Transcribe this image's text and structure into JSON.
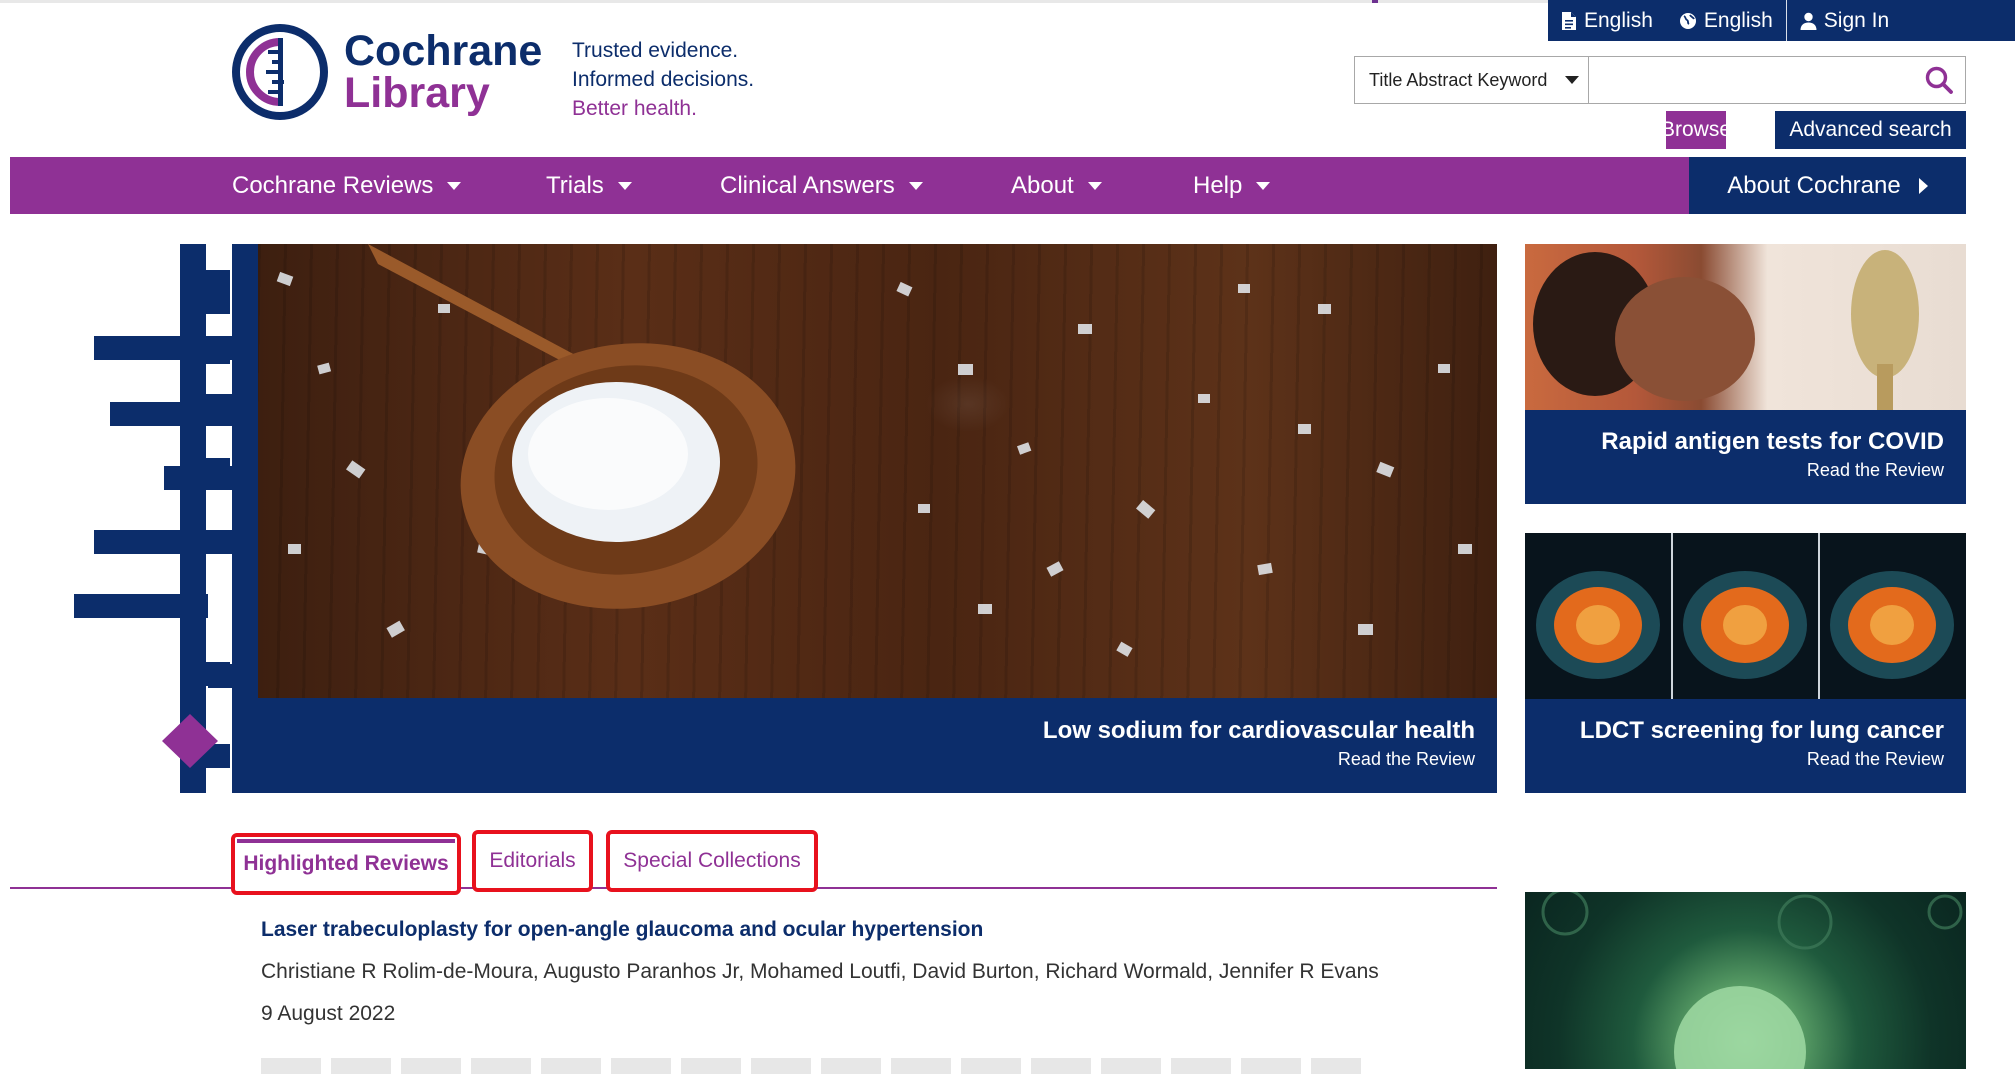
{
  "utility": {
    "items": [
      {
        "label": "English",
        "icon": "document-icon"
      },
      {
        "label": "English",
        "icon": "globe-icon"
      },
      {
        "label": "Sign In",
        "icon": "user-icon"
      }
    ]
  },
  "logo": {
    "line1": "Cochrane",
    "line2": "Library"
  },
  "tagline": {
    "line1": "Trusted evidence.",
    "line2": "Informed decisions.",
    "line3": "Better health."
  },
  "search": {
    "scope": "Title Abstract Keyword",
    "value": "",
    "placeholder": ""
  },
  "buttons": {
    "browse": "Browse",
    "advanced": "Advanced search"
  },
  "nav": {
    "items": [
      {
        "label": "Cochrane Reviews"
      },
      {
        "label": "Trials"
      },
      {
        "label": "Clinical Answers"
      },
      {
        "label": "About"
      },
      {
        "label": "Help"
      }
    ],
    "about_cochrane": "About Cochrane"
  },
  "hero": {
    "title": "Low sodium for cardiovascular health",
    "sub": "Read the Review"
  },
  "side": [
    {
      "title": "Rapid antigen tests for COVID",
      "sub": "Read the Review"
    },
    {
      "title": "LDCT screening for lung cancer",
      "sub": "Read the Review"
    }
  ],
  "tabs": [
    {
      "label": "Highlighted Reviews",
      "active": true
    },
    {
      "label": "Editorials",
      "active": false
    },
    {
      "label": "Special Collections",
      "active": false
    }
  ],
  "review": {
    "title": "Laser trabeculoplasty for open-angle glaucoma and ocular hypertension",
    "authors": "Christiane R Rolim-de-Moura, Augusto Paranhos Jr, Mohamed Loutfi, David Burton, Richard Wormald, Jennifer R Evans",
    "date": "9 August 2022"
  },
  "colors": {
    "navy": "#0c2d6b",
    "purple": "#8f3195",
    "highlight": "#e8111d"
  }
}
